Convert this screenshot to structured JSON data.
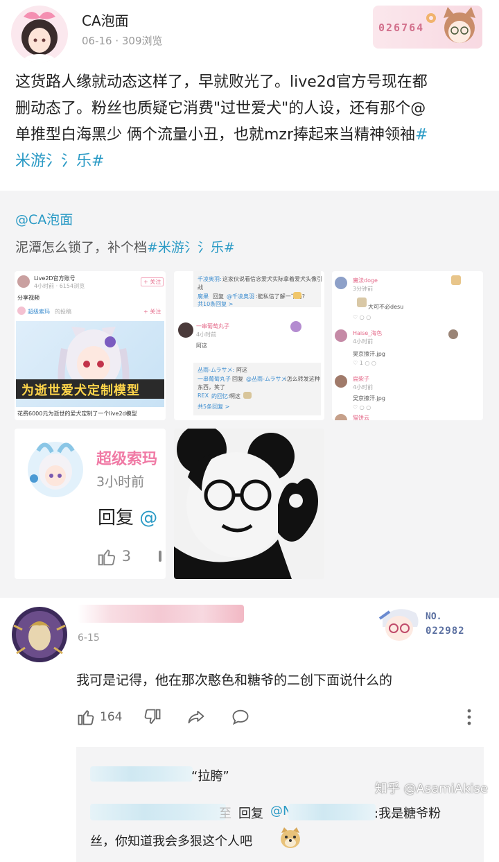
{
  "post": {
    "author": "CA泡面",
    "meta": "06-16 · 309浏览",
    "badge_number": "026764",
    "body_line1": "这货路人缘就动态这样了，早就败光了。live2d官方号现在都",
    "body_line2": "删动态了。粉丝也质疑它消费\"过世爱犬\"的人设，还有那个@",
    "body_line3_text": "单推型白海黑少 俩个流量小丑，也就mzr捧起来当精神领袖",
    "body_line3_hash": "#",
    "body_line4_hash": "米游氵氵乐#"
  },
  "repost": {
    "author": "@CA泡面",
    "text": "泥潭怎么锁了，补个档",
    "hashtag": "#米游氵氵乐#",
    "thumb1": {
      "account": "Live2D官方账号",
      "meta": "4小时前 · 6154浏览",
      "follow": "+ 关注",
      "share": "分享视频",
      "sub_account": "超级索玛",
      "sub_suffix": "的投稿",
      "sub_follow": "+ 关注",
      "poster_text": "为逝世爱犬定制模型",
      "caption": "花费6000元为逝世的爱犬定制了一个live2d模型"
    },
    "thumb2": {
      "line1a": "千凌奥羽:",
      "line1b": "这家伙说看信念爱犬实际拿着爱犬头像引",
      "line2": "战",
      "line3a": "腐果",
      "line3b": "回复",
      "line3c": "@千凌奥羽",
      "line3d": ":能私信了解一下吗?",
      "line4": "共10条回复 >",
      "user": "一串葡萄丸子",
      "user_time": "4小时前",
      "reply": "阿这",
      "r1a": "丛雨-ムラサメ:",
      "r1b": "阿这",
      "r2a": "一串葡萄丸子",
      "r2b": "回复",
      "r2c": "@丛雨-ムラサメ",
      "r2d": ":怎么转发这种",
      "r3": "东西，笑了",
      "r4a": "REX",
      "r4b": "的回忆:",
      "r4c": "啊这",
      "r5": "共5条回复 >"
    },
    "thumb3": {
      "u1": "魔法doge",
      "u1_time": "3分钟前",
      "u1_text": "大可不必desu",
      "u2": "Haise_海色",
      "u2_time": "4小时前",
      "u2_text": "吴京擦汗.jpg",
      "u3": "扁柴子",
      "u3_time": "4小时前",
      "u3_text": "吴京擦汗.jpg",
      "u4": "猫饼云",
      "like1": "1"
    },
    "thumb4": {
      "name": "超级索玛",
      "time": "3小时前",
      "reply": "回复",
      "at": "@",
      "likes": "3"
    }
  },
  "comment": {
    "date": "6-15",
    "badge_label": "NO.",
    "badge_number": "022982",
    "text": "我可是记得，他在那次憨色和糖爷的二创下面说什么的",
    "likes": "164",
    "reply_quote": "“拉胯”",
    "reply_fragment": "至",
    "reply_word": "回复",
    "reply_at": "@",
    "reply_at_tail": "N",
    "reply_end": ":我是糖爷粉",
    "reply_line2": "丝，你知道我会多狠这个人吧"
  },
  "watermark": "知乎 @AsamiAkise",
  "colors": {
    "link": "#2a9ac5",
    "bg_gray": "#f4f4f5",
    "pink": "#f07aa5"
  }
}
